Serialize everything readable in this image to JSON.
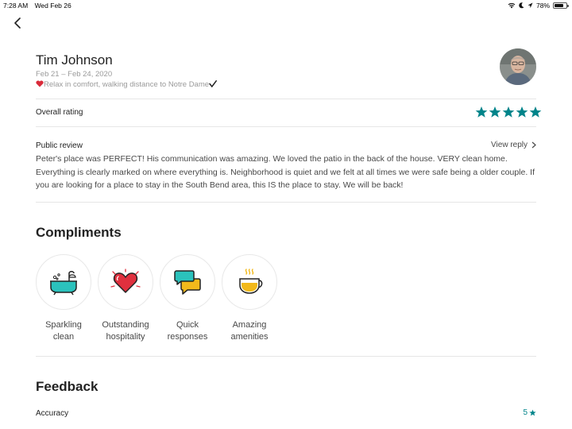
{
  "status_bar": {
    "time": "7:28 AM",
    "date": "Wed Feb 26",
    "battery": "78%",
    "battery_level": 0.78
  },
  "review": {
    "guest_name": "Tim Johnson",
    "dates": "Feb 21 – Feb 24, 2020",
    "listing_title": "Relax in comfort, walking distance to Notre Dame",
    "overall_rating_label": "Overall rating",
    "overall_rating": 5,
    "public_review_label": "Public review",
    "view_reply_label": "View reply",
    "public_review_text": "Peter's place was PERFECT! His communication was amazing. We loved the patio in the back of the house. VERY clean home. Everything is clearly marked on where everything is. Neighborhood is quiet and we felt at all times we were safe being a older couple. If you are looking for a place to stay in the South Bend area, this IS the place to stay. We will be back!"
  },
  "compliments": {
    "title": "Compliments",
    "items": [
      {
        "icon": "bathtub-icon",
        "label_line1": "Sparkling",
        "label_line2": "clean"
      },
      {
        "icon": "heart-icon",
        "label_line1": "Outstanding",
        "label_line2": "hospitality"
      },
      {
        "icon": "chat-bubbles-icon",
        "label_line1": "Quick",
        "label_line2": "responses"
      },
      {
        "icon": "tea-cup-icon",
        "label_line1": "Amazing",
        "label_line2": "amenities"
      }
    ]
  },
  "feedback": {
    "title": "Feedback",
    "items": [
      {
        "label": "Accuracy",
        "value": "5"
      }
    ]
  },
  "colors": {
    "accent": "#00848a",
    "text": "#222222",
    "muted": "#9a9a9a",
    "heart": "#e0303e",
    "yellow": "#f2b91b"
  }
}
